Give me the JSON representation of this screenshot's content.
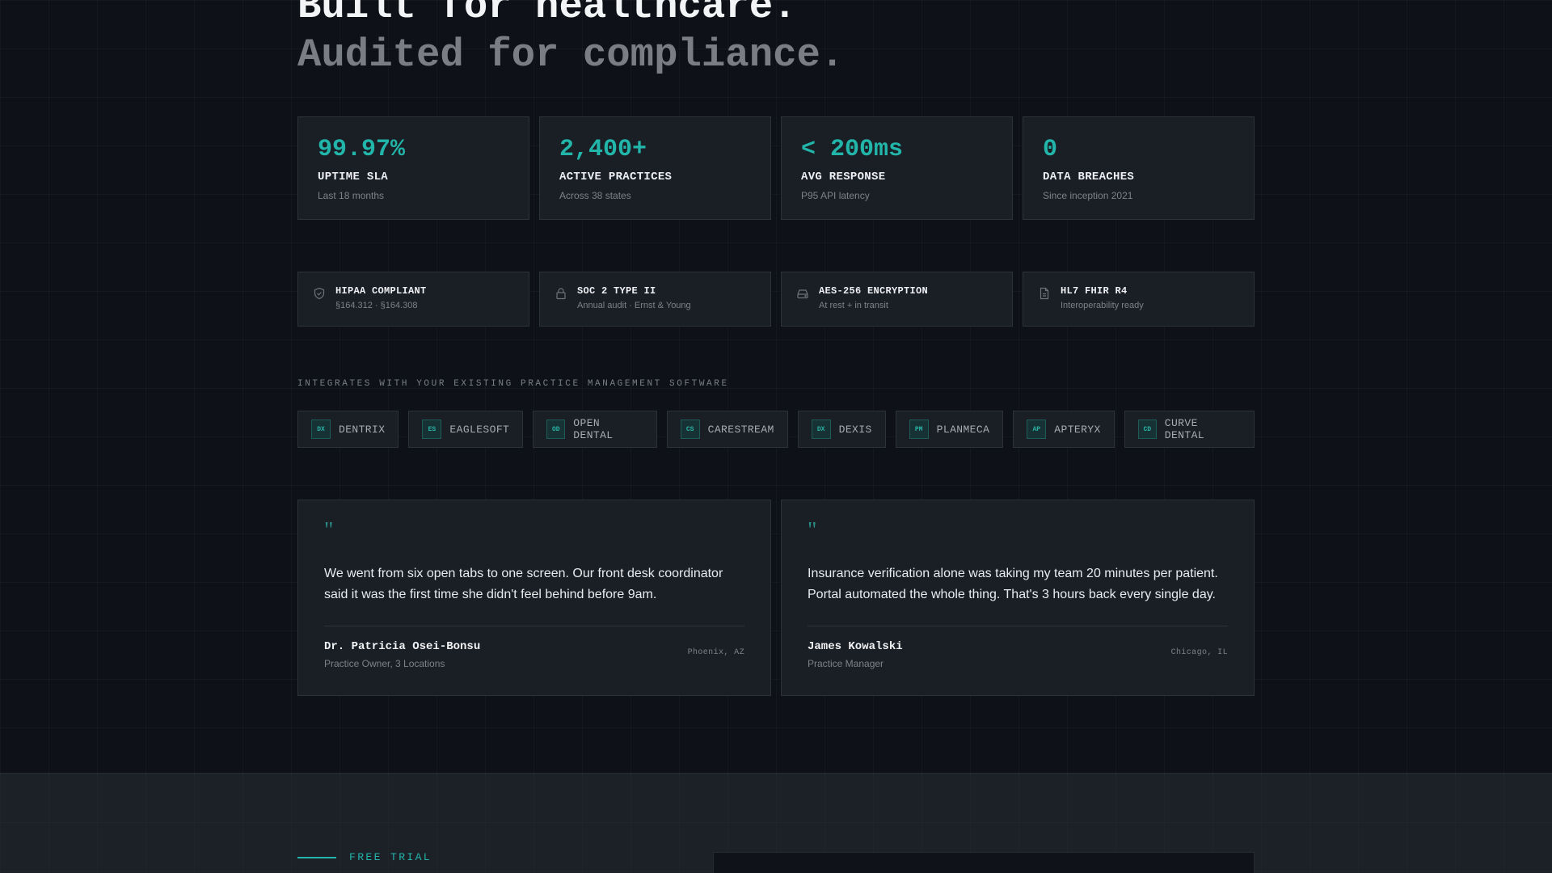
{
  "headline": {
    "line1": "Built for healthcare.",
    "line2": "Audited for compliance."
  },
  "stats": [
    {
      "value": "99.97%",
      "label": "UPTIME SLA",
      "sub": "Last 18 months"
    },
    {
      "value": "2,400+",
      "label": "ACTIVE PRACTICES",
      "sub": "Across 38 states"
    },
    {
      "value": "< 200ms",
      "label": "AVG RESPONSE",
      "sub": "P95 API latency"
    },
    {
      "value": "0",
      "label": "DATA BREACHES",
      "sub": "Since inception 2021"
    }
  ],
  "compliance": [
    {
      "icon": "shield-icon",
      "title": "HIPAA COMPLIANT",
      "sub": "§164.312 · §164.308"
    },
    {
      "icon": "lock-icon",
      "title": "SOC 2 TYPE II",
      "sub": "Annual audit · Ernst & Young"
    },
    {
      "icon": "database-icon",
      "title": "AES-256 ENCRYPTION",
      "sub": "At rest + in transit"
    },
    {
      "icon": "document-icon",
      "title": "HL7 FHIR R4",
      "sub": "Interoperability ready"
    }
  ],
  "integrations": {
    "label": "INTEGRATES WITH YOUR EXISTING PRACTICE MANAGEMENT SOFTWARE",
    "items": [
      {
        "badge": "DX",
        "name": "DENTRIX"
      },
      {
        "badge": "ES",
        "name": "EAGLESOFT"
      },
      {
        "badge": "OD",
        "name": "OPEN DENTAL"
      },
      {
        "badge": "CS",
        "name": "CARESTREAM"
      },
      {
        "badge": "DX",
        "name": "DEXIS"
      },
      {
        "badge": "PM",
        "name": "PLANMECA"
      },
      {
        "badge": "AP",
        "name": "APTERYX"
      },
      {
        "badge": "CD",
        "name": "CURVE DENTAL"
      }
    ]
  },
  "testimonials": [
    {
      "mark": "\"",
      "quote": "We went from six open tabs to one screen. Our front desk coordinator said it was the first time she didn't feel behind before 9am.",
      "name": "Dr. Patricia Osei-Bonsu",
      "role": "Practice Owner, 3 Locations",
      "location": "Phoenix, AZ"
    },
    {
      "mark": "\"",
      "quote": "Insurance verification alone was taking my team 20 minutes per patient. Portal automated the whole thing. That's 3 hours back every single day.",
      "name": "James Kowalski",
      "role": "Practice Manager",
      "location": "Chicago, IL"
    }
  ],
  "trial": {
    "label": "FREE TRIAL"
  },
  "colors": {
    "accent": "#22b5aa",
    "background": "#0e1218",
    "card": "#1a1e25"
  }
}
